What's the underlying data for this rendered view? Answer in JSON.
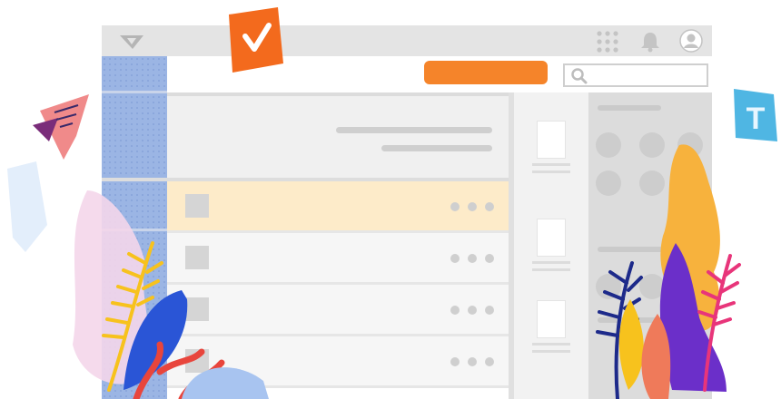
{
  "icons": {
    "logo": "logo-icon",
    "apps": "apps-grid-icon",
    "bell": "bell-icon",
    "avatar": "avatar-icon",
    "search": "search-icon",
    "check_card": "checkmark-icon",
    "t_card": "letter-t-icon"
  },
  "decor": {
    "t_card_text": "T"
  },
  "colors": {
    "accent": "#f5842a",
    "sidebar": "#9bb5e4",
    "selected_row": "#fdebc9",
    "titlebar": "#e4e4e4"
  },
  "list": {
    "rows": [
      {
        "selected": true
      },
      {
        "selected": false
      },
      {
        "selected": false
      },
      {
        "selected": false
      }
    ]
  }
}
